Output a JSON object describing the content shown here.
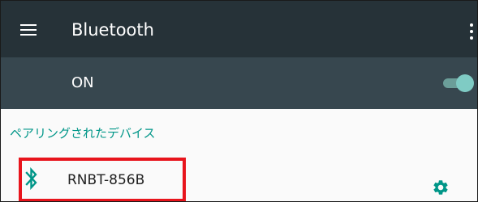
{
  "app_bar": {
    "title": "Bluetooth",
    "menu_icon": "menu-icon",
    "overflow_icon": "more-vert-icon"
  },
  "master_switch": {
    "label": "ON",
    "state": "on",
    "colors": {
      "thumb": "#7fcbc4",
      "track": "#6b9e99"
    }
  },
  "paired_section": {
    "header": "ペアリングされたデバイス",
    "devices": [
      {
        "name": "RNBT-856B",
        "icon": "bluetooth-icon",
        "settings_icon": "gear-icon"
      }
    ]
  },
  "colors": {
    "app_bar_bg": "#263238",
    "switch_bar_bg": "#37474f",
    "accent": "#009688",
    "highlight": "#e8141c"
  }
}
